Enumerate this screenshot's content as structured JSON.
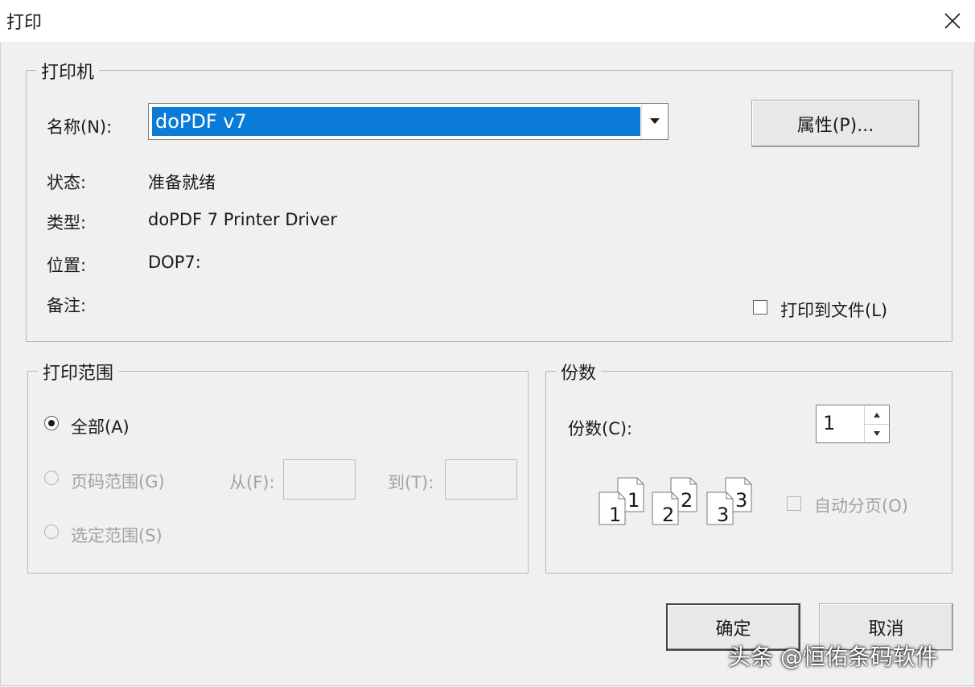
{
  "window": {
    "title": "打印",
    "close_icon": "close-icon"
  },
  "printer_group": {
    "legend": "打印机",
    "name_label": "名称(N):",
    "name_value": "doPDF v7",
    "properties_button": "属性(P)...",
    "status_label": "状态:",
    "status_value": "准备就绪",
    "type_label": "类型:",
    "type_value": "doPDF 7 Printer Driver",
    "location_label": "位置:",
    "location_value": "DOP7:",
    "comment_label": "备注:",
    "comment_value": "",
    "print_to_file_label": "打印到文件(L)",
    "print_to_file_checked": false
  },
  "range_group": {
    "legend": "打印范围",
    "all_label": "全部(A)",
    "pages_label": "页码范围(G)",
    "from_label": "从(F):",
    "from_value": "",
    "to_label": "到(T):",
    "to_value": "",
    "selection_label": "选定范围(S)",
    "selected": "all"
  },
  "copies_group": {
    "legend": "份数",
    "copies_label": "份数(C):",
    "copies_value": "1",
    "collate_label": "自动分页(O)",
    "collate_checked": false,
    "collate_icon": "collate-pages-icon"
  },
  "buttons": {
    "ok": "确定",
    "cancel": "取消"
  },
  "watermark": "头条 @恒佑条码软件",
  "colors": {
    "selection": "#0a7bd6",
    "background": "#f0f0f0",
    "disabled_text": "#a2a2a2"
  }
}
